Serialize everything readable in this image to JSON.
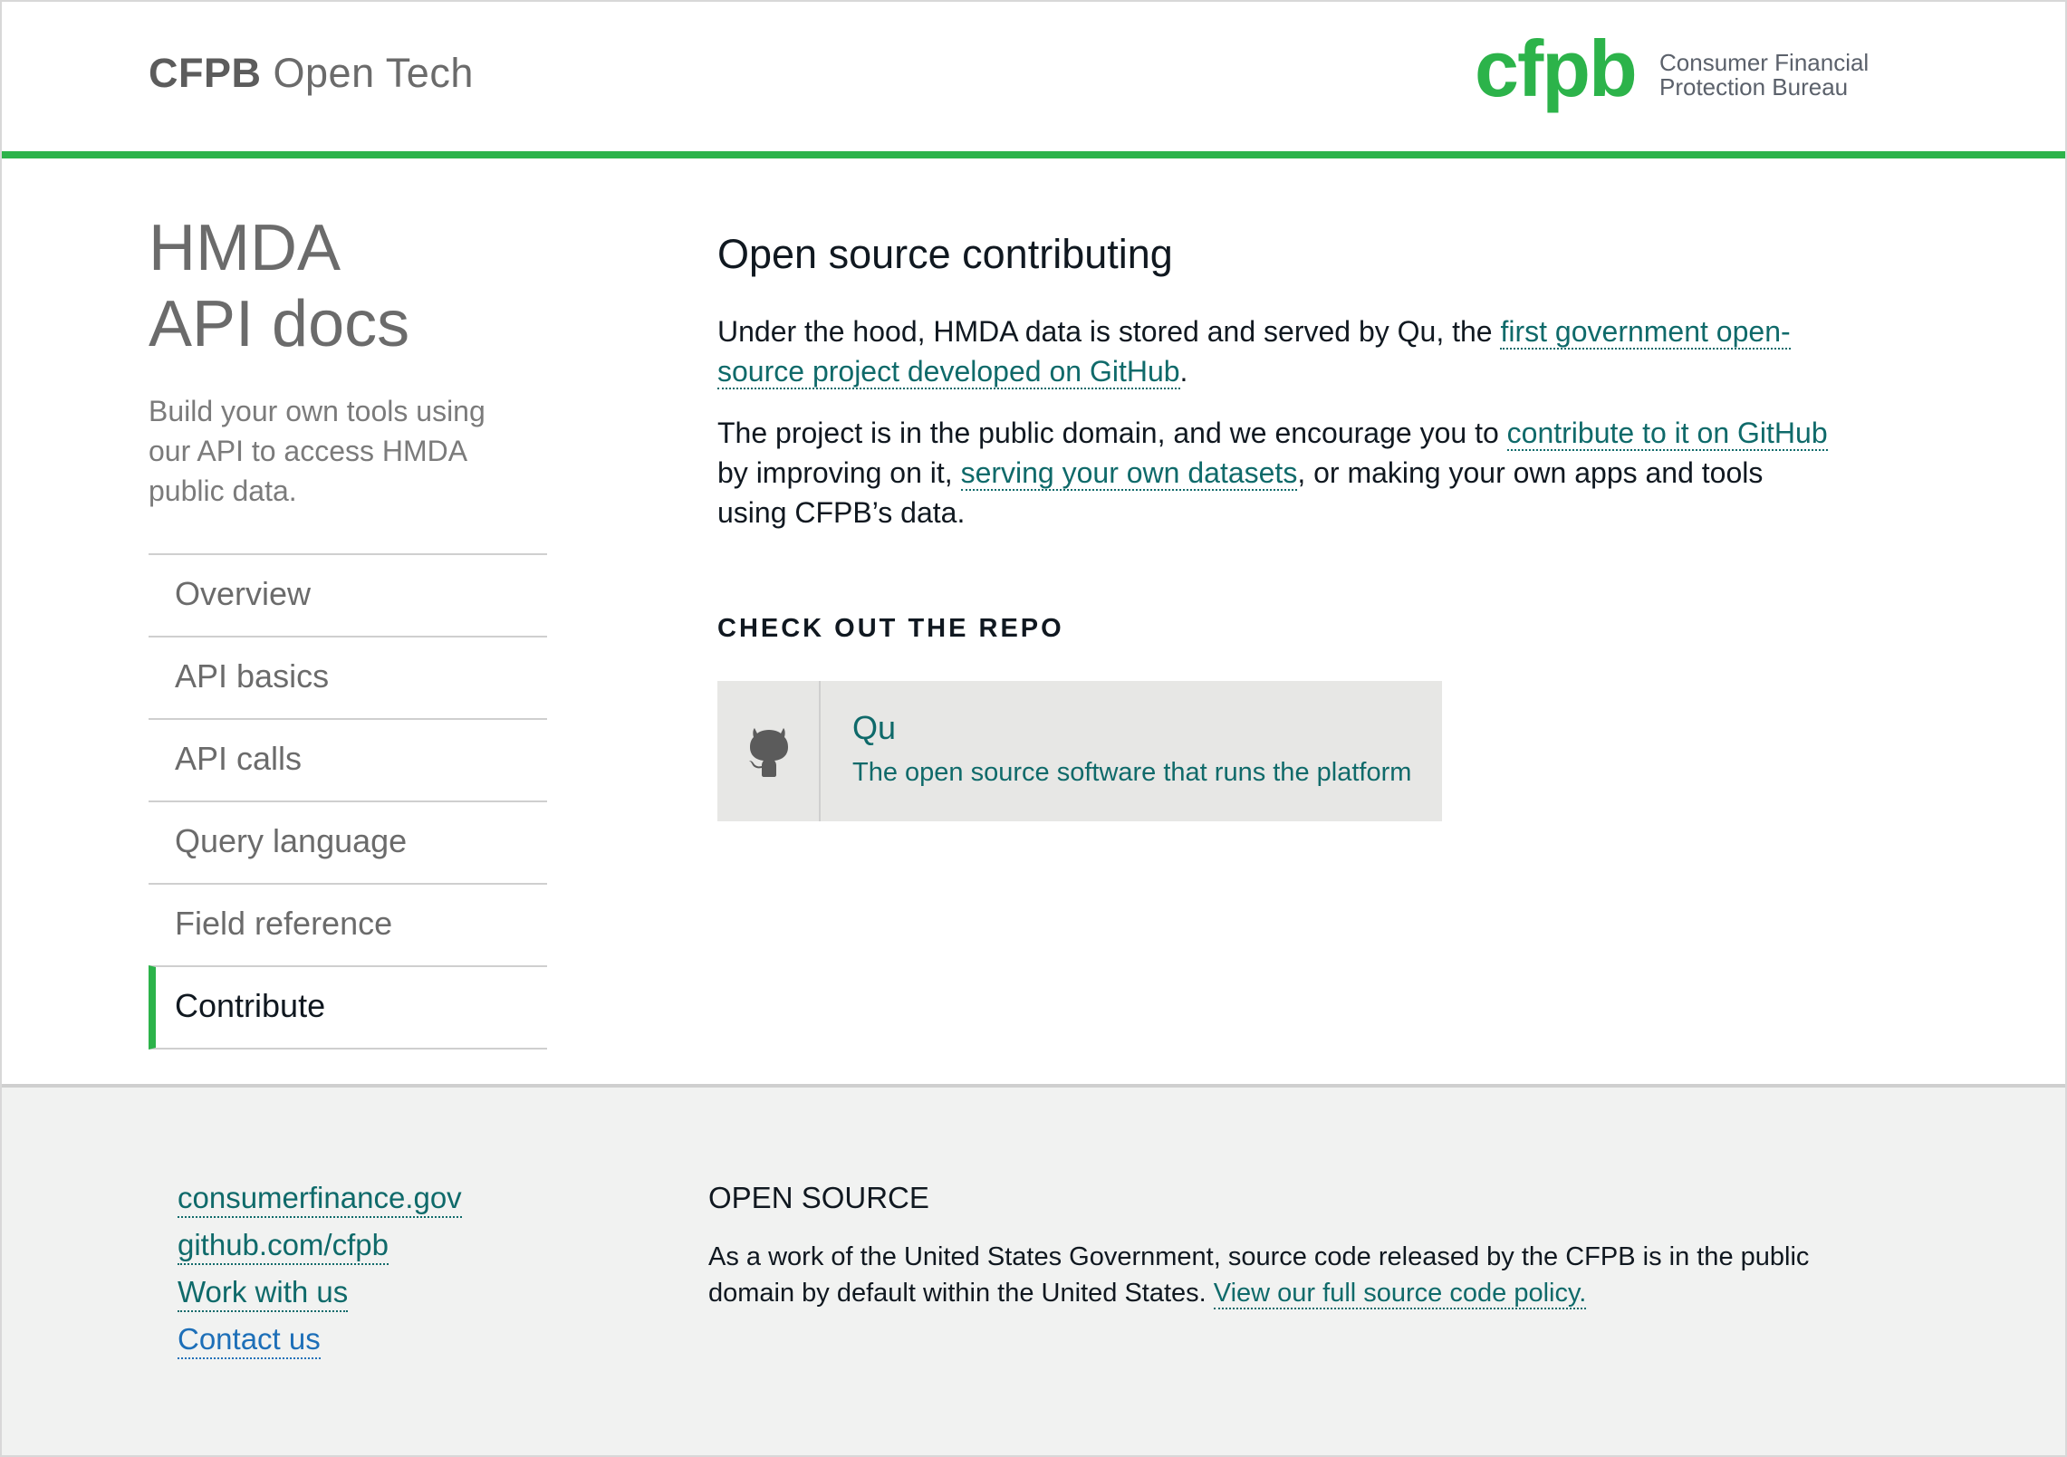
{
  "header": {
    "title_strong": "CFPB",
    "title_rest": "Open Tech",
    "logo_wordmark": "cfpb",
    "logo_line1": "Consumer Financial",
    "logo_line2": "Protection Bureau",
    "accent_color": "#2cb34a"
  },
  "sidebar": {
    "title_line1": "HMDA",
    "title_line2": "API docs",
    "description": "Build your own tools using our API to access HMDA public data.",
    "nav": [
      {
        "label": "Overview",
        "active": false
      },
      {
        "label": "API basics",
        "active": false
      },
      {
        "label": "API calls",
        "active": false
      },
      {
        "label": "Query language",
        "active": false
      },
      {
        "label": "Field reference",
        "active": false
      },
      {
        "label": "Contribute",
        "active": true
      }
    ]
  },
  "main": {
    "heading": "Open source contributing",
    "p1": {
      "before": "Under the hood, HMDA data is stored and served by Qu, the ",
      "link": "first government open-source project developed on GitHub",
      "after": "."
    },
    "p2": {
      "before": "The project is in the public domain, and we encourage you to ",
      "link1": "contribute to it on GitHub",
      "middle": " by improving on it, ",
      "link2": "serving your own datasets",
      "after": ", or making your own apps and tools using CFPB’s data."
    },
    "repo_label": "CHECK OUT THE REPO",
    "repo": {
      "icon": "github-octocat-icon",
      "name": "Qu",
      "description": "The open source software that runs the platform"
    }
  },
  "footer": {
    "links": [
      "consumerfinance.gov",
      "github.com/cfpb",
      "Work with us",
      "Contact us"
    ],
    "os_heading": "OPEN SOURCE",
    "os_text": "As a work of the United States Government, source code released by the CFPB is in the public domain by default within the United States. ",
    "os_link": "View our full source code policy."
  }
}
